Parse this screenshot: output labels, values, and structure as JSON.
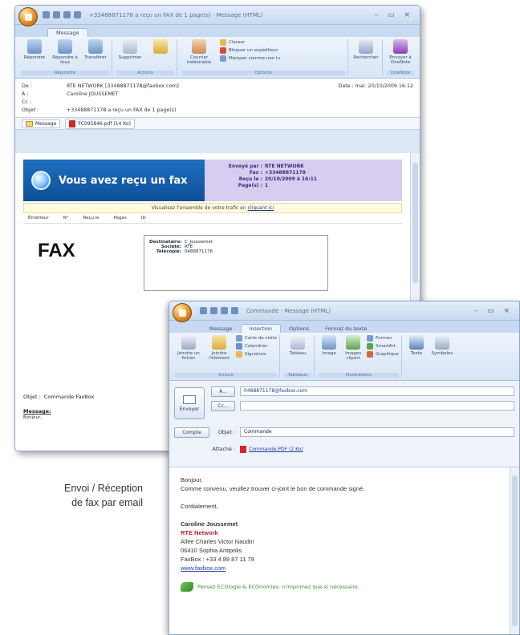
{
  "win1": {
    "title": "+33488871178 a reçu un FAX de 1 page(s) - Message (HTML)",
    "tab": "Message",
    "ribbon_buttons": [
      "Répondre",
      "Répondre à tous",
      "Transférer",
      "Supprimer",
      "Courrier indésirable",
      "Rechercher",
      "Envoyer à OneNote"
    ],
    "ribbon_small": [
      "Classer",
      "Bloquer un expéditeur",
      "Marquer comme non lu"
    ],
    "ribbon_groups": [
      "Répondre",
      "Actions",
      "Options",
      "OneNote"
    ],
    "headers": {
      "de_label": "De :",
      "de": "RTE NETWORK [33488871178@faxbox.com]",
      "a_label": "À :",
      "a": "Caroline JOUSSEMET",
      "cc_label": "Cc :",
      "cc": "",
      "objet_label": "Objet :",
      "objet": "+33488871178 a reçu un FAX de 1 page(s)",
      "date": "Date : mar. 20/10/2009 16:12"
    },
    "attachments": [
      "Message",
      "FC095846.pdf (14 Ko)"
    ],
    "banner_title": "Vous avez reçu un fax",
    "banner_info": [
      {
        "k": "Envoyé par :",
        "v": "RTE NETWORK"
      },
      {
        "k": "Fax :",
        "v": "+33488871178"
      },
      {
        "k": "Reçu le :",
        "v": "20/10/2009 à 16:11"
      },
      {
        "k": "Page(s) :",
        "v": "1"
      }
    ],
    "notice_text": "Visualisez l'ensemble de votre trafic en",
    "notice_link": "cliquant ici",
    "faxstrip": [
      "Émetteur",
      "N°",
      "Reçu le",
      "Pages",
      "ID"
    ],
    "fax_label": "FAX",
    "recipient": [
      {
        "k": "Destinataire:",
        "v": "C_Joussemet"
      },
      {
        "k": "Société:",
        "v": "RTE"
      },
      {
        "k": "Télécopie:",
        "v": "0488871178"
      }
    ],
    "objet_fax_label": "Objet :",
    "objet_fax": "Commande FaxBox",
    "message_title": "Message:",
    "message_body": "Bonjour,"
  },
  "caption": {
    "line1": "Envoi / Réception",
    "line2": "de fax par email"
  },
  "win2": {
    "title": "Commande - Message (HTML)",
    "tabs": [
      "Message",
      "Insertion",
      "Options",
      "Format du texte"
    ],
    "ribbon_buttons": [
      "Joindre un fichier",
      "Joindre l'élément",
      "Tableau",
      "Image",
      "Images clipart",
      "Texte",
      "Symboles"
    ],
    "ribbon_small": [
      "Carte de visite",
      "Calendrier",
      "Signature",
      "Formes",
      "SmartArt",
      "Graphique"
    ],
    "ribbon_groups": [
      "Inclure",
      "Tableaux",
      "Illustrations"
    ],
    "send_label": "Envoyer",
    "to_button": "À...",
    "to_value": "0488871178@faxbox.com",
    "cc_button": "Cc...",
    "cc_value": "",
    "account_button": "Compte",
    "objet_label": "Objet :",
    "objet_value": "Commande",
    "attached_label": "Attaché :",
    "attached_file": "Commande.PDF (2 Ko)",
    "body": {
      "greeting": "Bonjour,",
      "line1": "Comme convenu, veuillez trouver ci-joint le bon de commande signé.",
      "closing": "Cordialement,",
      "sig_name": "Caroline Joussemet",
      "sig_company": "RTE Network",
      "sig_address1": "Allée Charles Victor Naudin",
      "sig_address2": "06410 Sophia Antipolis",
      "sig_fax": "FaxBox : +33 4 89 87 11 79",
      "sig_web": "www.faxbox.com",
      "eco": "Pensez ECOlogie & ECOnomies: n'imprimez que si nécessaire."
    }
  },
  "colors": {
    "banner_blue": "#1f6fbf",
    "banner_purple": "#d8ccf0",
    "company_red": "#c0232c",
    "eco_green": "#3a8f2e"
  }
}
